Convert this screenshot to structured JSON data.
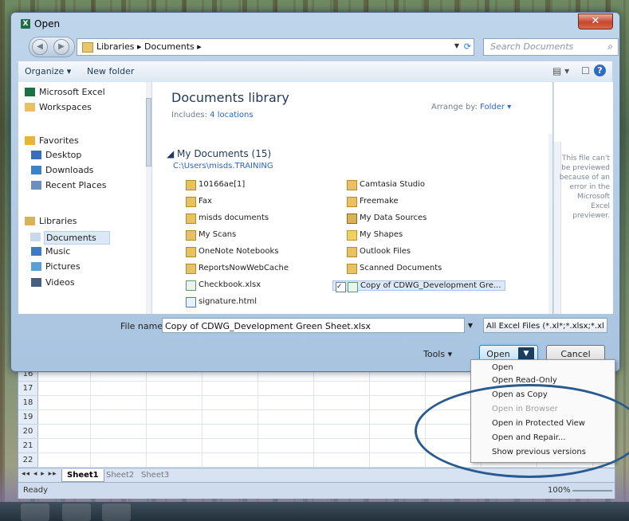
{
  "window": {
    "title": "Open",
    "close": "✕"
  },
  "address": {
    "path": "Libraries ▸ Documents ▸",
    "search_placeholder": "Search Documents"
  },
  "toolbar": {
    "organize": "Organize ▾",
    "new_folder": "New folder",
    "help": "?"
  },
  "nav": {
    "items": [
      {
        "label": "Microsoft Excel",
        "icon": "excel-icon"
      },
      {
        "label": "Workspaces",
        "icon": "folder-icon"
      },
      {
        "label": "Favorites",
        "icon": "star-icon"
      },
      {
        "label": "Desktop",
        "icon": "desktop-icon"
      },
      {
        "label": "Downloads",
        "icon": "downloads-icon"
      },
      {
        "label": "Recent Places",
        "icon": "recent-places-icon"
      },
      {
        "label": "Libraries",
        "icon": "libraries-icon"
      },
      {
        "label": "Documents",
        "icon": "documents-icon"
      },
      {
        "label": "Music",
        "icon": "music-icon"
      },
      {
        "label": "Pictures",
        "icon": "pictures-icon"
      },
      {
        "label": "Videos",
        "icon": "videos-icon"
      }
    ]
  },
  "library": {
    "title": "Documents library",
    "includes_label": "Includes:",
    "includes_link": "4 locations",
    "arrange_label": "Arrange by:",
    "arrange_value": "Folder ▾",
    "group_header": "◢ My Documents (15)",
    "group_path": "C:\\Users\\misds.TRAINING",
    "files_left": [
      {
        "name": "10166ae[1]",
        "type": "folder"
      },
      {
        "name": "Fax",
        "type": "folder"
      },
      {
        "name": "misds documents",
        "type": "folder"
      },
      {
        "name": "My Scans",
        "type": "folder"
      },
      {
        "name": "OneNote Notebooks",
        "type": "folder"
      },
      {
        "name": "ReportsNowWebCache",
        "type": "folder"
      },
      {
        "name": "Checkbook.xlsx",
        "type": "xls"
      },
      {
        "name": "signature.html",
        "type": "htm"
      }
    ],
    "files_right": [
      {
        "name": "Camtasia Studio",
        "type": "folder"
      },
      {
        "name": "Freemake",
        "type": "folder"
      },
      {
        "name": "My Data Sources",
        "type": "db"
      },
      {
        "name": "My Shapes",
        "type": "vsd"
      },
      {
        "name": "Outlook Files",
        "type": "folder"
      },
      {
        "name": "Scanned Documents",
        "type": "folder"
      },
      {
        "name": "Copy of CDWG_Development Gre...",
        "type": "xls",
        "selected": true
      }
    ]
  },
  "preview": {
    "message": "This file can't be previewed because of an error in the Microsoft Excel previewer."
  },
  "footer": {
    "file_name_label": "File name:",
    "file_name_value": "Copy of CDWG_Development Green Sheet.xlsx",
    "filter": "All Excel Files (*.xl*;*.xlsx;*.xl",
    "tools": "Tools  ▾",
    "open": "Open",
    "cancel": "Cancel"
  },
  "open_menu": {
    "items": [
      {
        "label": "Open",
        "enabled": true
      },
      {
        "label": "Open Read-Only",
        "enabled": true
      },
      {
        "label": "Open as Copy",
        "enabled": true
      },
      {
        "label": "Open in Browser",
        "enabled": false
      },
      {
        "label": "Open in Protected View",
        "enabled": true
      },
      {
        "label": "Open and Repair...",
        "enabled": true
      },
      {
        "label": "Show previous versions",
        "enabled": true
      }
    ]
  },
  "excel": {
    "rows": [
      "16",
      "17",
      "18",
      "19",
      "20",
      "21",
      "22"
    ],
    "sheets": [
      "Sheet1",
      "Sheet2",
      "Sheet3"
    ],
    "status": "Ready",
    "zoom": "100%"
  },
  "colors": {
    "annotation_ellipse": "#2a5b8e",
    "accent": "#1e395b",
    "link": "#2a66c7"
  }
}
